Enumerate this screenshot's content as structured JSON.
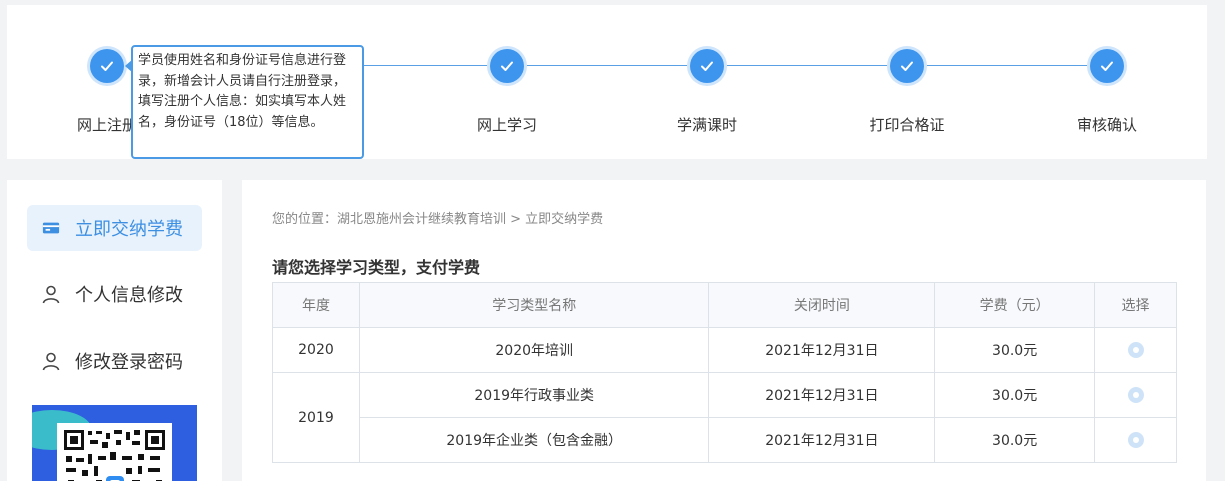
{
  "steps": [
    {
      "label": "网上注册"
    },
    {
      "label": "网上学习"
    },
    {
      "label": "学满课时"
    },
    {
      "label": "打印合格证"
    },
    {
      "label": "审核确认"
    }
  ],
  "tooltip": {
    "text": "学员使用姓名和身份证号信息进行登录，新增会计人员请自行注册登录，填写注册个人信息：如实填写本人姓名，身份证号（18位）等信息。"
  },
  "sidebar": {
    "items": [
      {
        "label": "立即交纳学费",
        "icon": "card-icon",
        "active": true
      },
      {
        "label": "个人信息修改",
        "icon": "user-icon",
        "active": false
      },
      {
        "label": "修改登录密码",
        "icon": "user-icon",
        "active": false
      }
    ]
  },
  "breadcrumb": {
    "prefix": "您的位置：",
    "path": "湖北恩施州会计继续教育培训 > 立即交纳学费"
  },
  "main": {
    "title": "请您选择学习类型，支付学费"
  },
  "table": {
    "headers": [
      "年度",
      "学习类型名称",
      "关闭时间",
      "学费（元）",
      "选择"
    ],
    "rows": [
      {
        "year": "2020",
        "name": "2020年培训",
        "close": "2021年12月31日",
        "fee": "30.0元"
      },
      {
        "year": "2019",
        "name": "2019年行政事业类",
        "close": "2021年12月31日",
        "fee": "30.0元"
      },
      {
        "year": "",
        "name": "2019年企业类（包含金融）",
        "close": "2021年12月31日",
        "fee": "30.0元"
      }
    ]
  },
  "colors": {
    "accent": "#3d95ee",
    "active_bg": "#e8f2fd",
    "active_text": "#3d8fe2"
  }
}
